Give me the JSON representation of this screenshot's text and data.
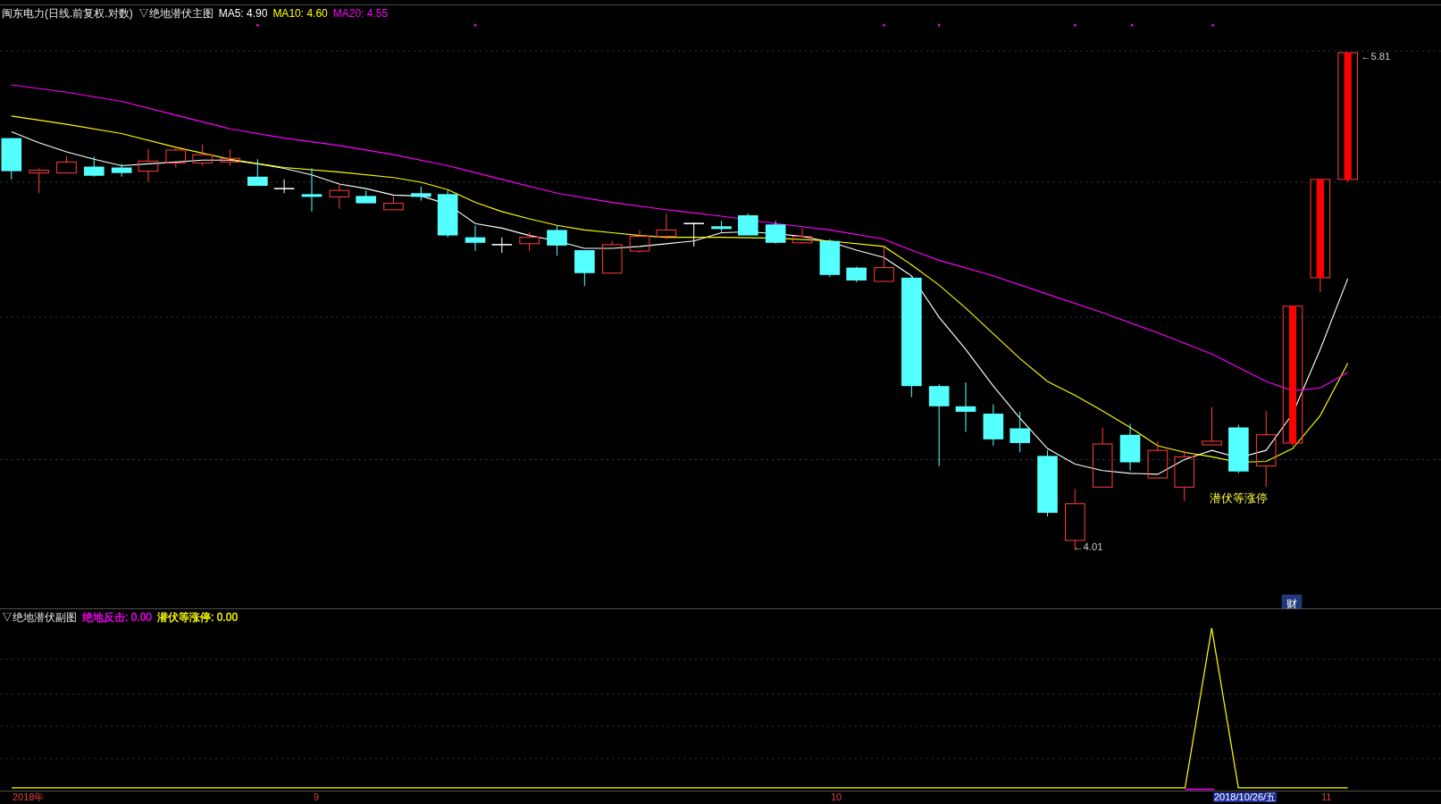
{
  "main_chart": {
    "title": "闽东电力(日线.前复权.对数)",
    "indicator": "▽绝地潜伏主图",
    "legend": [
      {
        "label": "MA5: 4.90",
        "color": "#ffffff"
      },
      {
        "label": "MA10: 4.60",
        "color": "#ffff00"
      },
      {
        "label": "MA20: 4.55",
        "color": "#ff00ff"
      }
    ],
    "high_label": "←5.81",
    "low_label": "←4.01",
    "annotation": "潜伏等涨停",
    "marker": "财"
  },
  "sub_chart": {
    "indicator": "▽绝地潜伏副图",
    "legend": [
      {
        "label": "绝地反击: 0.00",
        "color": "#ff00ff"
      },
      {
        "label": "潜伏等涨停: 0.00",
        "color": "#ffff00"
      }
    ]
  },
  "x_axis": {
    "labels": [
      {
        "text": "2018年",
        "selected": false
      },
      {
        "text": "9",
        "selected": false
      },
      {
        "text": "10",
        "selected": false
      },
      {
        "text": "2018/10/26/五",
        "selected": true
      },
      {
        "text": "11",
        "selected": false
      }
    ]
  }
}
